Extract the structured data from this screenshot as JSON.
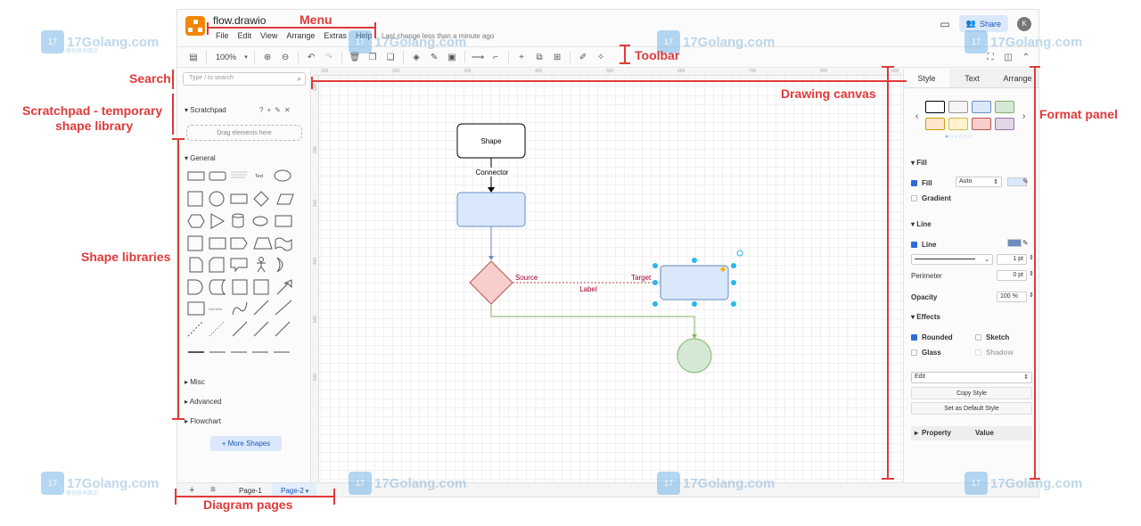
{
  "app": {
    "title": "flow.drawio",
    "last_change": "Last change less than a minute ago",
    "share_label": "Share",
    "avatar_initial": "K",
    "menu": [
      "File",
      "Edit",
      "View",
      "Arrange",
      "Extras",
      "Help"
    ]
  },
  "toolbar": {
    "zoom": "100%",
    "icons": [
      "format-panel-icon",
      "zoom-in-icon",
      "zoom-out-icon",
      "undo-icon",
      "redo-icon",
      "delete-icon",
      "to-front-icon",
      "to-back-icon",
      "fill-color-icon",
      "line-color-icon",
      "shadow-icon",
      "connection-icon",
      "waypoints-icon",
      "insert-icon",
      "table-icon",
      "edit-icon",
      "magic-icon",
      "fullscreen-icon",
      "panel-icon",
      "collapse-icon"
    ]
  },
  "sidebar": {
    "search_placeholder": "Type / to search",
    "scratchpad_label": "Scratchpad",
    "scratchpad_drop": "Drag elements here",
    "general_label": "General",
    "sections": [
      "Misc",
      "Advanced",
      "Flowchart"
    ],
    "more_shapes_label": "+ More Shapes",
    "text_shape_label": "Text"
  },
  "canvas": {
    "shape_label": "Shape",
    "connector_label": "Connector",
    "source_label": "Source",
    "target_label": "Target",
    "edge_label": "Label",
    "ruler_top": [
      "100",
      "200",
      "300",
      "400",
      "500",
      "600",
      "700",
      "800",
      "900"
    ],
    "ruler_left": [
      "100",
      "200",
      "300",
      "400",
      "500",
      "600"
    ]
  },
  "format_panel": {
    "tabs": [
      "Style",
      "Text",
      "Arrange"
    ],
    "fill_section": "Fill",
    "fill_label": "Fill",
    "fill_value": "Auto",
    "gradient_label": "Gradient",
    "line_section": "Line",
    "line_label": "Line",
    "line_width": "1 pt",
    "perimeter_label": "Perimeter",
    "perimeter_value": "0 pt",
    "opacity_label": "Opacity",
    "opacity_value": "100 %",
    "effects_section": "Effects",
    "rounded_label": "Rounded",
    "sketch_label": "Sketch",
    "glass_label": "Glass",
    "shadow_label": "Shadow",
    "edit_select": "Edit",
    "copy_style": "Copy Style",
    "set_default": "Set as Default Style",
    "property_label": "Property",
    "value_label": "Value",
    "swatch_colors": [
      "#ffffff",
      "#f5f5f5",
      "#dae8fc",
      "#d5e8d4",
      "#ffe6cc",
      "#fff2cc",
      "#f8cecc",
      "#e1d5e7"
    ]
  },
  "pages": {
    "tabs": [
      "Page-1",
      "Page-2"
    ],
    "active": "Page-2"
  },
  "annotations": {
    "menu": "Menu",
    "toolbar": "Toolbar",
    "search": "Search",
    "scratchpad": "Scratchpad - temporary",
    "scratchpad_2": "shape library",
    "shape_libraries": "Shape libraries",
    "drawing_canvas": "Drawing canvas",
    "format_panel": "Format panel",
    "diagram_pages": "Diagram pages"
  },
  "watermark": {
    "site": "17Golang.com",
    "subtitle": "原创技术图文"
  },
  "colors": {
    "annotation": "#e03a3a",
    "accent": "#1a56b5",
    "selection": "#29b6f2"
  }
}
